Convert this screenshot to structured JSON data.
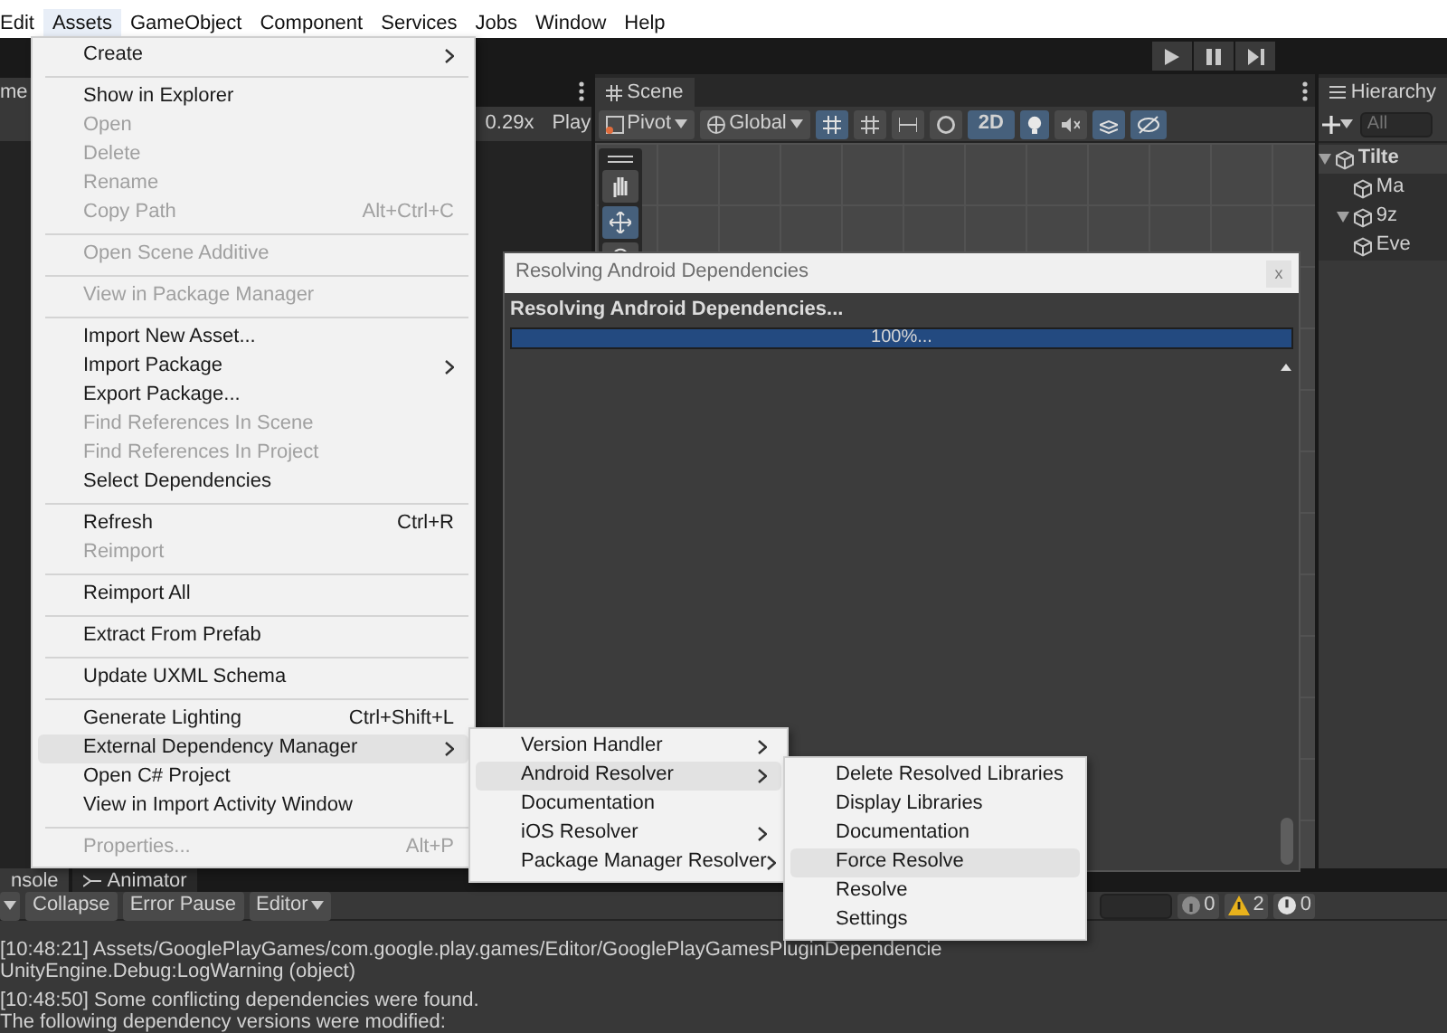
{
  "menubar": [
    {
      "label": "Edit",
      "selected": false
    },
    {
      "label": "Assets",
      "selected": true
    },
    {
      "label": "GameObject",
      "selected": false
    },
    {
      "label": "Component",
      "selected": false
    },
    {
      "label": "Services",
      "selected": false
    },
    {
      "label": "Jobs",
      "selected": false
    },
    {
      "label": "Window",
      "selected": false
    },
    {
      "label": "Help",
      "selected": false
    }
  ],
  "game_panel": {
    "tab": "me",
    "zoom": "0.29x",
    "play_label": "Play"
  },
  "scene_panel": {
    "tab": "Scene",
    "pivot": "Pivot",
    "space": "Global",
    "mode_2d": "2D"
  },
  "hierarchy": {
    "title": "Hierarchy",
    "search_placeholder": "All",
    "tree": [
      {
        "label": "Tilte",
        "expanded": true,
        "children": [
          {
            "label": "Ma"
          },
          {
            "label": "9z",
            "expanded": true
          },
          {
            "label": "Eve"
          }
        ]
      }
    ]
  },
  "dialog": {
    "title": "Resolving Android Dependencies",
    "close": "x",
    "status": "Resolving Android Dependencies...",
    "progress": {
      "level": 1,
      "reading": "100%..."
    }
  },
  "assets_menu": {
    "items": [
      {
        "kind": "item",
        "label": "Create",
        "submenu": true
      },
      {
        "kind": "separator"
      },
      {
        "kind": "item",
        "label": "Show in Explorer"
      },
      {
        "kind": "item",
        "label": "Open",
        "disabled": true
      },
      {
        "kind": "item",
        "label": "Delete",
        "disabled": true
      },
      {
        "kind": "item",
        "label": "Rename",
        "disabled": true
      },
      {
        "kind": "item",
        "label": "Copy Path",
        "disabled": true,
        "shortcut": "Alt+Ctrl+C"
      },
      {
        "kind": "separator"
      },
      {
        "kind": "item",
        "label": "Open Scene Additive",
        "disabled": true
      },
      {
        "kind": "separator"
      },
      {
        "kind": "item",
        "label": "View in Package Manager",
        "disabled": true
      },
      {
        "kind": "separator"
      },
      {
        "kind": "item",
        "label": "Import New Asset..."
      },
      {
        "kind": "item",
        "label": "Import Package",
        "submenu": true
      },
      {
        "kind": "item",
        "label": "Export Package..."
      },
      {
        "kind": "item",
        "label": "Find References In Scene",
        "disabled": true
      },
      {
        "kind": "item",
        "label": "Find References In Project",
        "disabled": true
      },
      {
        "kind": "item",
        "label": "Select Dependencies"
      },
      {
        "kind": "separator"
      },
      {
        "kind": "item",
        "label": "Refresh",
        "shortcut": "Ctrl+R"
      },
      {
        "kind": "item",
        "label": "Reimport",
        "disabled": true
      },
      {
        "kind": "separator"
      },
      {
        "kind": "item",
        "label": "Reimport All"
      },
      {
        "kind": "separator"
      },
      {
        "kind": "item",
        "label": "Extract From Prefab"
      },
      {
        "kind": "separator"
      },
      {
        "kind": "item",
        "label": "Update UXML Schema"
      },
      {
        "kind": "separator"
      },
      {
        "kind": "item",
        "label": "Generate Lighting",
        "shortcut": "Ctrl+Shift+L"
      },
      {
        "kind": "item",
        "label": "External Dependency Manager",
        "submenu": true,
        "selected": true
      },
      {
        "kind": "item",
        "label": "Open C# Project"
      },
      {
        "kind": "item",
        "label": "View in Import Activity Window"
      },
      {
        "kind": "separator"
      },
      {
        "kind": "item",
        "label": "Properties...",
        "disabled": true,
        "shortcut": "Alt+P"
      }
    ]
  },
  "submenu": {
    "items": [
      {
        "kind": "item",
        "label": "Version Handler",
        "submenu": true
      },
      {
        "kind": "item",
        "label": "Android Resolver",
        "submenu": true,
        "selected": true
      },
      {
        "kind": "item",
        "label": "Documentation"
      },
      {
        "kind": "item",
        "label": "iOS Resolver",
        "submenu": true
      },
      {
        "kind": "item",
        "label": "Package Manager Resolver",
        "submenu": true
      }
    ]
  },
  "submenu_2": {
    "items": [
      {
        "kind": "item",
        "label": "Delete Resolved Libraries"
      },
      {
        "kind": "item",
        "label": "Display Libraries"
      },
      {
        "kind": "item",
        "label": "Documentation"
      },
      {
        "kind": "item",
        "label": "Force Resolve",
        "selected": true
      },
      {
        "kind": "item",
        "label": "Resolve"
      },
      {
        "kind": "item",
        "label": "Settings"
      }
    ]
  },
  "console": {
    "tabs": [
      {
        "label": "nsole",
        "selected": true
      },
      {
        "label": "Animator",
        "selected": false
      }
    ],
    "buttons": [
      "Collapse",
      "Error Pause"
    ],
    "filter": "Editor",
    "counts": [
      {
        "kind": "info",
        "count": "0"
      },
      {
        "kind": "warning",
        "count": "2"
      },
      {
        "kind": "error",
        "count": "0"
      }
    ],
    "entries": [
      {
        "lines": [
          "[10:48:21] Assets/GooglePlayGames/com.google.play.games/Editor/GooglePlayGamesPluginDependencie",
          "UnityEngine.Debug:LogWarning (object)"
        ]
      },
      {
        "lines": [
          "[10:48:50] Some conflicting dependencies were found.",
          "The following dependency versions were modified:"
        ]
      }
    ]
  }
}
